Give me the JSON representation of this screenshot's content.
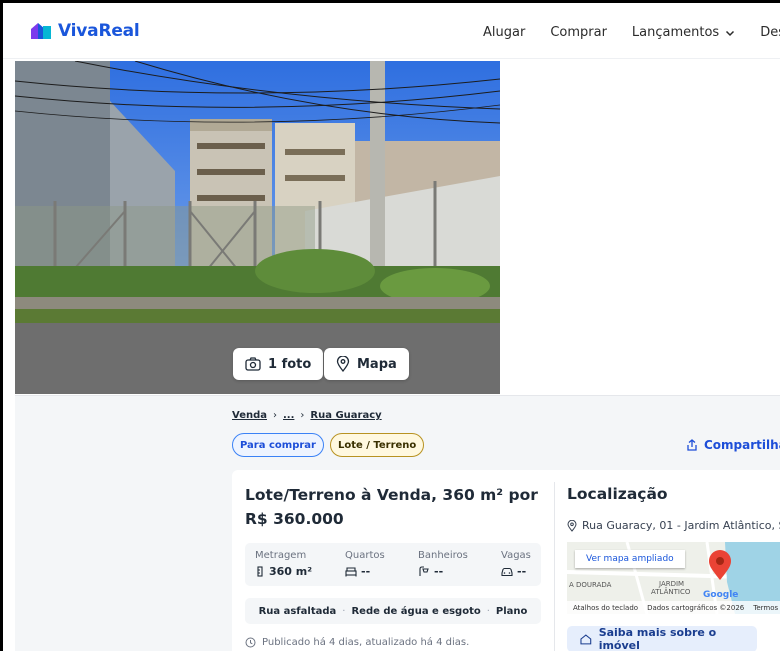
{
  "brand": {
    "name": "VivaReal",
    "color": "#1a56db"
  },
  "nav": {
    "items": [
      {
        "label": "Alugar"
      },
      {
        "label": "Comprar"
      },
      {
        "label": "Lançamentos",
        "icon": "chevron-down-icon"
      },
      {
        "label": "Des"
      }
    ]
  },
  "gallery": {
    "photo_button": "1 foto",
    "map_button": "Mapa"
  },
  "breadcrumb": {
    "items": [
      "Venda",
      "...",
      "Rua Guaracy"
    ]
  },
  "tags": [
    "Para comprar",
    "Lote / Terreno"
  ],
  "share_label": "Compartilhar",
  "listing": {
    "title": "Lote/Terreno à Venda, 360 m² por R$ 360.000",
    "stats": [
      {
        "label": "Metragem",
        "value": "360 m²",
        "icon": "ruler-icon"
      },
      {
        "label": "Quartos",
        "value": "--",
        "icon": "bed-icon"
      },
      {
        "label": "Banheiros",
        "value": "--",
        "icon": "shower-icon"
      },
      {
        "label": "Vagas",
        "value": "--",
        "icon": "car-icon"
      }
    ],
    "amenities": [
      "Rua asfaltada",
      "Rede de água e esgoto",
      "Plano"
    ],
    "published": "Publicado há 4 dias, atualizado há 4 dias."
  },
  "location": {
    "title": "Localização",
    "address": "Rua Guaracy, 01 - Jardim Atlântico, S",
    "map_link": "Ver mapa ampliado",
    "map_labels": [
      "A DOURADA",
      "JARDIM",
      "ATLÂNTICO"
    ],
    "map_footer": [
      "Atalhos do teclado",
      "Dados cartográficos ©2026",
      "Termos"
    ],
    "map_brand": "Google",
    "more_button": "Saiba mais sobre o imóvel"
  }
}
